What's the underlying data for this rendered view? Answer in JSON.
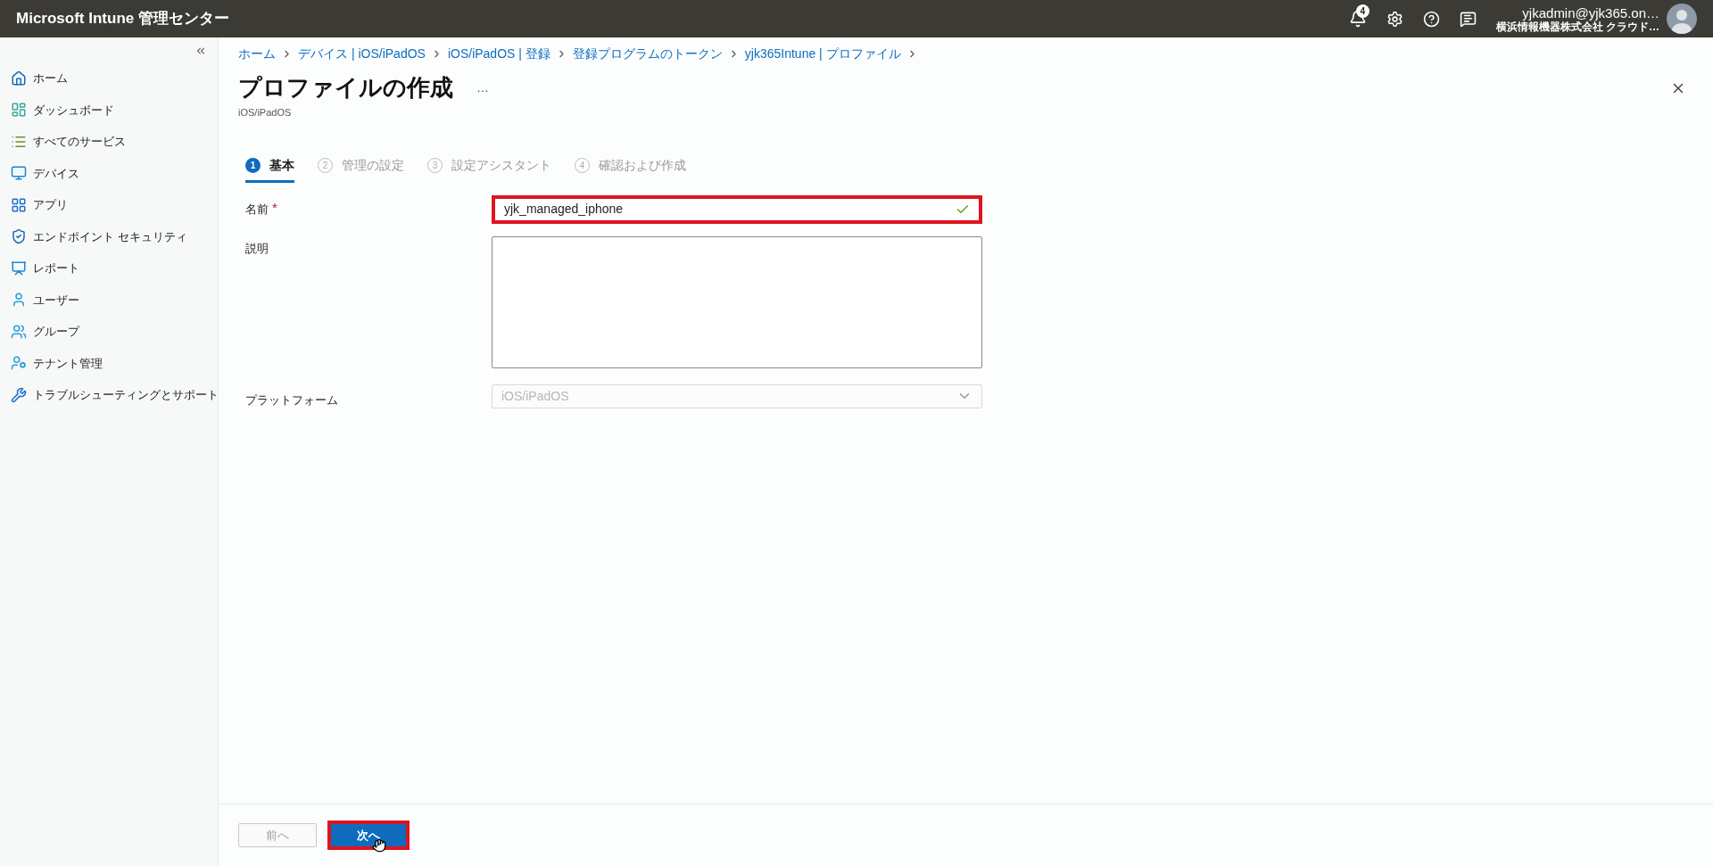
{
  "header": {
    "title": "Microsoft Intune 管理センター",
    "notification_count": "4",
    "account": {
      "email": "yjkadmin@yjk365.on…",
      "org": "横浜情報機器株式会社 クラウド…"
    }
  },
  "sidebar": {
    "items": [
      {
        "label": "ホーム"
      },
      {
        "label": "ダッシュボード"
      },
      {
        "label": "すべてのサービス"
      },
      {
        "label": "デバイス"
      },
      {
        "label": "アプリ"
      },
      {
        "label": "エンドポイント セキュリティ"
      },
      {
        "label": "レポート"
      },
      {
        "label": "ユーザー"
      },
      {
        "label": "グループ"
      },
      {
        "label": "テナント管理"
      },
      {
        "label": "トラブルシューティングとサポート"
      }
    ]
  },
  "breadcrumb": [
    "ホーム",
    "デバイス | iOS/iPadOS",
    "iOS/iPadOS | 登録",
    "登録プログラムのトークン",
    "yjk365Intune | プロファイル"
  ],
  "page": {
    "title": "プロファイルの作成",
    "more": "…",
    "subtitle": "iOS/iPadOS"
  },
  "steps": [
    {
      "number": "1",
      "label": "基本",
      "selected": true
    },
    {
      "number": "2",
      "label": "管理の設定",
      "selected": false
    },
    {
      "number": "3",
      "label": "設定アシスタント",
      "selected": false
    },
    {
      "number": "4",
      "label": "確認および作成",
      "selected": false
    }
  ],
  "form": {
    "name": {
      "label": "名前",
      "required_mark": "*",
      "value": "yjk_managed_iphone",
      "valid": true,
      "highlighted": true
    },
    "description": {
      "label": "説明"
    },
    "platform": {
      "label": "プラットフォーム",
      "value": "iOS/iPadOS",
      "disabled": true
    }
  },
  "footer": {
    "previous": {
      "label": "前へ",
      "disabled": true
    },
    "next": {
      "label": "次へ",
      "highlighted": true
    }
  }
}
